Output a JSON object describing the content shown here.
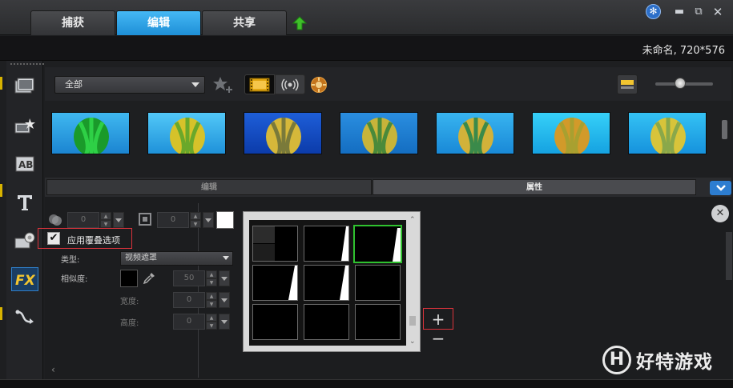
{
  "tabs": [
    {
      "label": "捕获",
      "active": false
    },
    {
      "label": "编辑",
      "active": true
    },
    {
      "label": "共享",
      "active": false
    }
  ],
  "project": {
    "title": "未命名, 720*576"
  },
  "library": {
    "category": "全部",
    "thumbnails": [
      {
        "name": "balloon-1"
      },
      {
        "name": "balloon-2"
      },
      {
        "name": "balloon-3"
      },
      {
        "name": "balloon-4"
      },
      {
        "name": "balloon-5"
      },
      {
        "name": "balloon-6"
      },
      {
        "name": "balloon-7"
      }
    ]
  },
  "options": {
    "tabs": {
      "edit": "编辑",
      "attributes": "属性"
    },
    "transparency_value": "0",
    "border_value": "0",
    "apply_overlay_label": "应用覆叠选项",
    "apply_overlay_checked": true,
    "type_label": "类型:",
    "type_value": "视频遮罩",
    "similarity_label": "相似度:",
    "similarity_value": "50",
    "width_label": "宽度:",
    "width_value": "0",
    "height_label": "高度:",
    "height_value": "0"
  },
  "watermark": {
    "logo": "H",
    "text": "好特游戏"
  },
  "colors": {
    "accent": "#1e8fd6",
    "selected_mask": "#2fc12f",
    "highlight_box": "#d9333b"
  }
}
